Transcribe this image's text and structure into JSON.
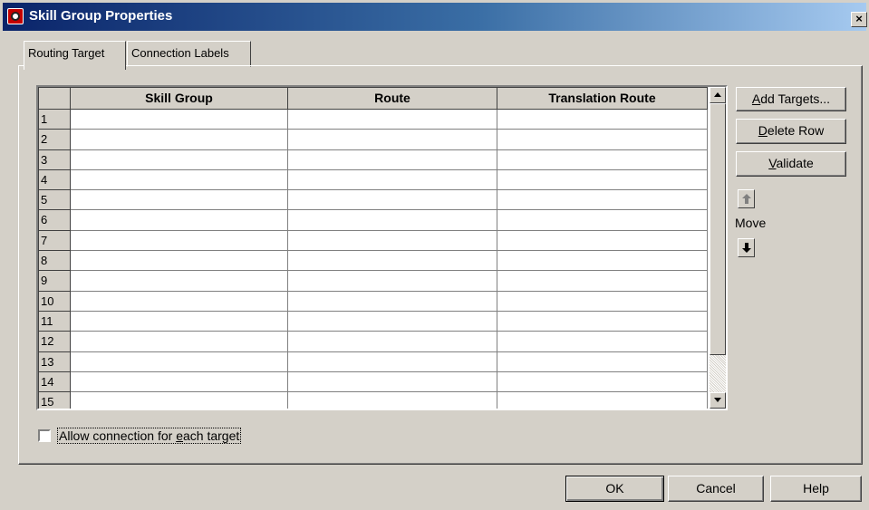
{
  "window": {
    "title": "Skill Group Properties",
    "close_glyph": "×"
  },
  "tabs": [
    {
      "label": "Routing Target",
      "active": true
    },
    {
      "label": "Connection Labels",
      "active": false
    }
  ],
  "grid": {
    "columns": [
      "Skill Group",
      "Route",
      "Translation Route"
    ],
    "row_numbers": [
      "1",
      "2",
      "3",
      "4",
      "5",
      "6",
      "7",
      "8",
      "9",
      "10",
      "11",
      "12",
      "13",
      "14",
      "15"
    ]
  },
  "side_buttons": {
    "add_targets": {
      "mnemonic": "A",
      "rest": "dd Targets..."
    },
    "delete_row": {
      "mnemonic": "D",
      "rest": "elete Row"
    },
    "validate": {
      "mnemonic": "V",
      "rest": "alidate"
    },
    "move_label": "Move",
    "move_up_icon": "arrow-up-icon",
    "move_down_icon": "arrow-down-icon"
  },
  "allow_connection": {
    "checked": false,
    "label_before": "Allow connection for ",
    "mnemonic": "e",
    "label_after": "ach target"
  },
  "footer": {
    "ok": "OK",
    "cancel": "Cancel",
    "help": "Help"
  },
  "colors": {
    "face": "#d4d0c8",
    "title_start": "#0a246a",
    "title_end": "#a6caf0"
  }
}
